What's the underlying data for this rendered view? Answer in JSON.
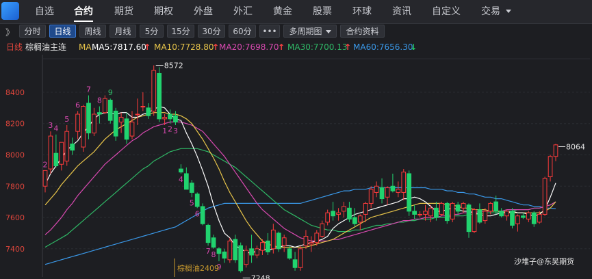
{
  "nav": {
    "items": [
      "自选",
      "合约",
      "期货",
      "期权",
      "外盘",
      "外汇",
      "黄金",
      "股票",
      "环球",
      "资讯",
      "自定义",
      "交易"
    ],
    "active": "合约"
  },
  "toolbar": {
    "expand_icon": "》",
    "buttons": [
      "分时",
      "日线",
      "周线",
      "月线",
      "5分",
      "15分",
      "30分",
      "60分",
      "•••",
      "多周期图",
      "合约资料"
    ],
    "active": "日线"
  },
  "ma_bar": {
    "period": "日线",
    "instrument": "棕榈油主连",
    "ma_label": "MA",
    "items": [
      {
        "text": "MA5:7817.60",
        "color": "#ffffff",
        "arrow": "↑",
        "arrow_color": "#ff4444"
      },
      {
        "text": "MA10:7728.80",
        "color": "#e8c54a",
        "arrow": "↑",
        "arrow_color": "#ff4444"
      },
      {
        "text": "MA20:7698.70",
        "color": "#d849b0",
        "arrow": "↑",
        "arrow_color": "#ff4444"
      },
      {
        "text": "MA30:7700.13",
        "color": "#2fb866",
        "arrow": "↑",
        "arrow_color": "#ff4444"
      },
      {
        "text": "MA60:7656.30",
        "color": "#3a98e8",
        "arrow": "↓",
        "arrow_color": "#22cc66"
      }
    ]
  },
  "watermark": "沙堆子@东吴期货",
  "contract_change_label": "棕榈油2409",
  "chart_data": {
    "type": "candlestick",
    "ylim": [
      7220,
      8640
    ],
    "yticks": [
      7400,
      7600,
      7800,
      8000,
      8200,
      8400
    ],
    "max_label": "8572",
    "min_label": "7248",
    "last_label": "8064",
    "colors": {
      "up": "#ff3c3c",
      "down": "#21d36f",
      "ma5": "#ffffff",
      "ma10": "#e8c54a",
      "ma20": "#d849b0",
      "ma30": "#2fb866",
      "ma60": "#3a98e8",
      "count": "#d849b0",
      "count_green": "#2fb866"
    },
    "candles": [
      [
        7800,
        7900,
        7760,
        7900
      ],
      [
        7910,
        8150,
        7880,
        8120
      ],
      [
        8010,
        8130,
        7920,
        7930
      ],
      [
        7940,
        8080,
        7900,
        8080
      ],
      [
        7960,
        8190,
        7930,
        8150
      ],
      [
        8070,
        8110,
        8000,
        8030
      ],
      [
        8150,
        8280,
        8100,
        8260
      ],
      [
        8050,
        8320,
        8020,
        8310
      ],
      [
        8330,
        8380,
        8100,
        8140
      ],
      [
        8140,
        8300,
        8120,
        8260
      ],
      [
        8270,
        8310,
        8200,
        8260
      ],
      [
        8270,
        8380,
        8260,
        8360
      ],
      [
        8350,
        8360,
        8200,
        8220
      ],
      [
        8280,
        8300,
        8090,
        8120
      ],
      [
        8210,
        8270,
        8140,
        8240
      ],
      [
        8230,
        8270,
        8070,
        8100
      ],
      [
        8120,
        8280,
        8100,
        8210
      ],
      [
        8260,
        8360,
        8190,
        8260
      ],
      [
        8310,
        8400,
        8280,
        8310
      ],
      [
        8300,
        8330,
        8230,
        8250
      ],
      [
        8280,
        8572,
        8250,
        8540
      ],
      [
        8520,
        8560,
        8210,
        8230
      ],
      [
        8230,
        8260,
        8190,
        8240
      ],
      [
        8260,
        8290,
        8200,
        8230
      ],
      [
        8250,
        8280,
        8190,
        8210
      ],
      [
        7910,
        7940,
        7880,
        7890
      ],
      [
        7880,
        7920,
        7780,
        7780
      ],
      [
        7820,
        7840,
        7730,
        7760
      ],
      [
        7750,
        7760,
        7660,
        7670
      ],
      [
        7670,
        7690,
        7550,
        7560
      ],
      [
        7550,
        7560,
        7420,
        7440
      ],
      [
        7470,
        7490,
        7400,
        7410
      ],
      [
        7400,
        7410,
        7320,
        7370
      ],
      [
        7380,
        7400,
        7310,
        7340
      ],
      [
        7330,
        7470,
        7310,
        7450
      ],
      [
        7460,
        7490,
        7310,
        7330
      ],
      [
        7420,
        7440,
        7248,
        7260
      ],
      [
        7300,
        7420,
        7280,
        7390
      ],
      [
        7400,
        7490,
        7310,
        7360
      ],
      [
        7360,
        7420,
        7340,
        7400
      ],
      [
        7390,
        7460,
        7360,
        7440
      ],
      [
        7450,
        7500,
        7360,
        7380
      ],
      [
        7400,
        7560,
        7370,
        7520
      ],
      [
        7500,
        7510,
        7380,
        7400
      ],
      [
        7420,
        7490,
        7380,
        7470
      ],
      [
        7400,
        7420,
        7330,
        7340
      ],
      [
        7330,
        7380,
        7260,
        7280
      ],
      [
        7280,
        7420,
        7260,
        7400
      ],
      [
        7420,
        7520,
        7400,
        7480
      ],
      [
        7430,
        7480,
        7380,
        7440
      ],
      [
        7440,
        7520,
        7420,
        7500
      ],
      [
        7480,
        7580,
        7470,
        7560
      ],
      [
        7570,
        7650,
        7550,
        7630
      ],
      [
        7640,
        7700,
        7580,
        7610
      ],
      [
        7620,
        7660,
        7580,
        7630
      ],
      [
        7640,
        7700,
        7600,
        7670
      ],
      [
        7660,
        7700,
        7570,
        7590
      ],
      [
        7600,
        7660,
        7540,
        7560
      ],
      [
        7570,
        7620,
        7520,
        7610
      ],
      [
        7620,
        7700,
        7570,
        7690
      ],
      [
        7690,
        7800,
        7660,
        7780
      ],
      [
        7760,
        7830,
        7730,
        7800
      ],
      [
        7790,
        7850,
        7690,
        7720
      ],
      [
        7730,
        7800,
        7680,
        7790
      ],
      [
        7800,
        7880,
        7760,
        7770
      ],
      [
        7760,
        7830,
        7730,
        7780
      ],
      [
        7760,
        7910,
        7710,
        7890
      ],
      [
        7880,
        7900,
        7610,
        7640
      ],
      [
        7640,
        7680,
        7590,
        7620
      ],
      [
        7620,
        7640,
        7600,
        7620
      ],
      [
        7620,
        7680,
        7580,
        7640
      ],
      [
        7610,
        7680,
        7570,
        7660
      ],
      [
        7660,
        7700,
        7580,
        7600
      ],
      [
        7620,
        7700,
        7610,
        7690
      ],
      [
        7690,
        7700,
        7560,
        7580
      ],
      [
        7590,
        7700,
        7570,
        7690
      ],
      [
        7680,
        7700,
        7620,
        7640
      ],
      [
        7660,
        7700,
        7630,
        7690
      ],
      [
        7680,
        7690,
        7470,
        7510
      ],
      [
        7510,
        7660,
        7500,
        7650
      ],
      [
        7650,
        7690,
        7560,
        7570
      ],
      [
        7580,
        7660,
        7560,
        7640
      ],
      [
        7640,
        7700,
        7620,
        7690
      ],
      [
        7700,
        7740,
        7620,
        7640
      ],
      [
        7640,
        7660,
        7600,
        7610
      ],
      [
        7610,
        7650,
        7580,
        7640
      ],
      [
        7640,
        7660,
        7530,
        7550
      ],
      [
        7560,
        7620,
        7510,
        7610
      ],
      [
        7610,
        7630,
        7590,
        7600
      ],
      [
        7590,
        7640,
        7570,
        7630
      ],
      [
        7630,
        7640,
        7540,
        7560
      ],
      [
        7570,
        7640,
        7560,
        7620
      ],
      [
        7620,
        7860,
        7610,
        7850
      ],
      [
        7860,
        8000,
        7830,
        7990
      ],
      [
        7990,
        8070,
        7960,
        8064
      ]
    ],
    "ma5": [
      7810,
      7880,
      7930,
      7980,
      8030,
      8060,
      8090,
      8140,
      8180,
      8230,
      8260,
      8270,
      8270,
      8260,
      8270,
      8270,
      8240,
      8240,
      8260,
      8270,
      8290,
      8310,
      8300,
      8260,
      8230,
      8220,
      8140,
      8070,
      7990,
      7900,
      7800,
      7680,
      7580,
      7500,
      7470,
      7420,
      7400,
      7380,
      7370,
      7390,
      7400,
      7390,
      7400,
      7410,
      7420,
      7420,
      7410,
      7420,
      7430,
      7440,
      7450,
      7460,
      7480,
      7530,
      7560,
      7580,
      7600,
      7620,
      7630,
      7640,
      7650,
      7660,
      7670,
      7680,
      7690,
      7700,
      7720,
      7720,
      7730,
      7720,
      7700,
      7670,
      7640,
      7640,
      7650,
      7660,
      7650,
      7640,
      7640,
      7630,
      7620,
      7610,
      7610,
      7620,
      7630,
      7630,
      7640,
      7630,
      7630,
      7620,
      7610,
      7620,
      7650,
      7730,
      7820
    ],
    "ma10": [
      7680,
      7720,
      7760,
      7810,
      7850,
      7890,
      7930,
      7960,
      7990,
      8020,
      8060,
      8100,
      8130,
      8160,
      8180,
      8200,
      8220,
      8240,
      8250,
      8260,
      8270,
      8270,
      8270,
      8260,
      8260,
      8250,
      8230,
      8200,
      8150,
      8100,
      8040,
      7980,
      7910,
      7830,
      7760,
      7700,
      7640,
      7580,
      7530,
      7490,
      7450,
      7430,
      7420,
      7410,
      7410,
      7410,
      7410,
      7410,
      7410,
      7420,
      7430,
      7440,
      7450,
      7460,
      7480,
      7500,
      7520,
      7540,
      7560,
      7580,
      7600,
      7610,
      7620,
      7630,
      7640,
      7650,
      7660,
      7670,
      7680,
      7690,
      7690,
      7690,
      7690,
      7690,
      7680,
      7680,
      7670,
      7660,
      7660,
      7650,
      7650,
      7650,
      7640,
      7640,
      7640,
      7630,
      7630,
      7630,
      7630,
      7630,
      7630,
      7630,
      7640,
      7660,
      7700
    ],
    "ma20": [
      7490,
      7520,
      7560,
      7600,
      7650,
      7690,
      7740,
      7780,
      7820,
      7860,
      7900,
      7940,
      7970,
      8000,
      8030,
      8060,
      8090,
      8110,
      8140,
      8160,
      8180,
      8190,
      8200,
      8210,
      8210,
      8210,
      8200,
      8190,
      8170,
      8150,
      8110,
      8070,
      8030,
      7990,
      7940,
      7890,
      7840,
      7790,
      7740,
      7690,
      7650,
      7620,
      7590,
      7560,
      7530,
      7510,
      7490,
      7470,
      7460,
      7450,
      7450,
      7450,
      7450,
      7460,
      7460,
      7470,
      7480,
      7490,
      7500,
      7510,
      7520,
      7530,
      7540,
      7550,
      7560,
      7570,
      7580,
      7580,
      7590,
      7590,
      7600,
      7600,
      7600,
      7610,
      7610,
      7620,
      7620,
      7630,
      7630,
      7630,
      7640,
      7640,
      7640,
      7640,
      7640,
      7650,
      7650,
      7650,
      7650,
      7650,
      7660,
      7660,
      7670,
      7680,
      7700
    ],
    "ma30": [
      7410,
      7430,
      7450,
      7470,
      7490,
      7520,
      7550,
      7580,
      7610,
      7640,
      7670,
      7700,
      7730,
      7760,
      7790,
      7820,
      7850,
      7880,
      7910,
      7930,
      7960,
      7980,
      8000,
      8020,
      8030,
      8040,
      8040,
      8040,
      8040,
      8030,
      8020,
      8000,
      7980,
      7960,
      7940,
      7920,
      7890,
      7860,
      7830,
      7800,
      7770,
      7740,
      7710,
      7680,
      7650,
      7630,
      7610,
      7590,
      7570,
      7550,
      7540,
      7530,
      7520,
      7520,
      7510,
      7510,
      7510,
      7520,
      7520,
      7530,
      7540,
      7550,
      7550,
      7560,
      7560,
      7570,
      7570,
      7580,
      7580,
      7590,
      7590,
      7590,
      7600,
      7600,
      7600,
      7610,
      7610,
      7610,
      7620,
      7620,
      7620,
      7630,
      7630,
      7630,
      7640,
      7640,
      7640,
      7650,
      7650,
      7650,
      7660,
      7660,
      7670,
      7680,
      7700
    ],
    "ma60": [
      7300,
      7310,
      7320,
      7330,
      7340,
      7350,
      7360,
      7370,
      7380,
      7390,
      7400,
      7410,
      7420,
      7430,
      7440,
      7450,
      7460,
      7470,
      7480,
      7490,
      7500,
      7510,
      7520,
      7530,
      7540,
      7560,
      7580,
      7600,
      7620,
      7640,
      7660,
      7670,
      7680,
      7690,
      7690,
      7690,
      7690,
      7690,
      7690,
      7690,
      7690,
      7690,
      7690,
      7690,
      7690,
      7690,
      7690,
      7690,
      7700,
      7710,
      7720,
      7730,
      7740,
      7750,
      7760,
      7770,
      7770,
      7780,
      7780,
      7780,
      7790,
      7790,
      7790,
      7790,
      7790,
      7790,
      7790,
      7790,
      7790,
      7790,
      7790,
      7780,
      7780,
      7780,
      7770,
      7770,
      7760,
      7760,
      7750,
      7750,
      7740,
      7730,
      7730,
      7720,
      7720,
      7710,
      7700,
      7690,
      7680,
      7680,
      7670,
      7670,
      7660,
      7660,
      7656
    ],
    "count_labels": [
      {
        "i": 0,
        "t": "2"
      },
      {
        "i": 1,
        "t": "3"
      },
      {
        "i": 2,
        "t": "4"
      },
      {
        "i": 4,
        "t": "5"
      },
      {
        "i": 6,
        "t": "6"
      },
      {
        "i": 8,
        "t": "7"
      },
      {
        "i": 10,
        "t": "8"
      },
      {
        "i": 12,
        "t": "9",
        "green": true
      },
      {
        "i": 22,
        "t": "1",
        "below": true
      },
      {
        "i": 23,
        "t": "2",
        "below": true
      },
      {
        "i": 24,
        "t": "3",
        "below": true
      },
      {
        "i": 25,
        "t": "4",
        "below": true
      },
      {
        "i": 27,
        "t": "5",
        "below": true
      },
      {
        "i": 28,
        "t": "6",
        "below": true
      },
      {
        "i": 30,
        "t": "7",
        "below": true
      },
      {
        "i": 31,
        "t": "8",
        "below": true
      },
      {
        "i": 32,
        "t": "9",
        "below": true
      }
    ]
  }
}
